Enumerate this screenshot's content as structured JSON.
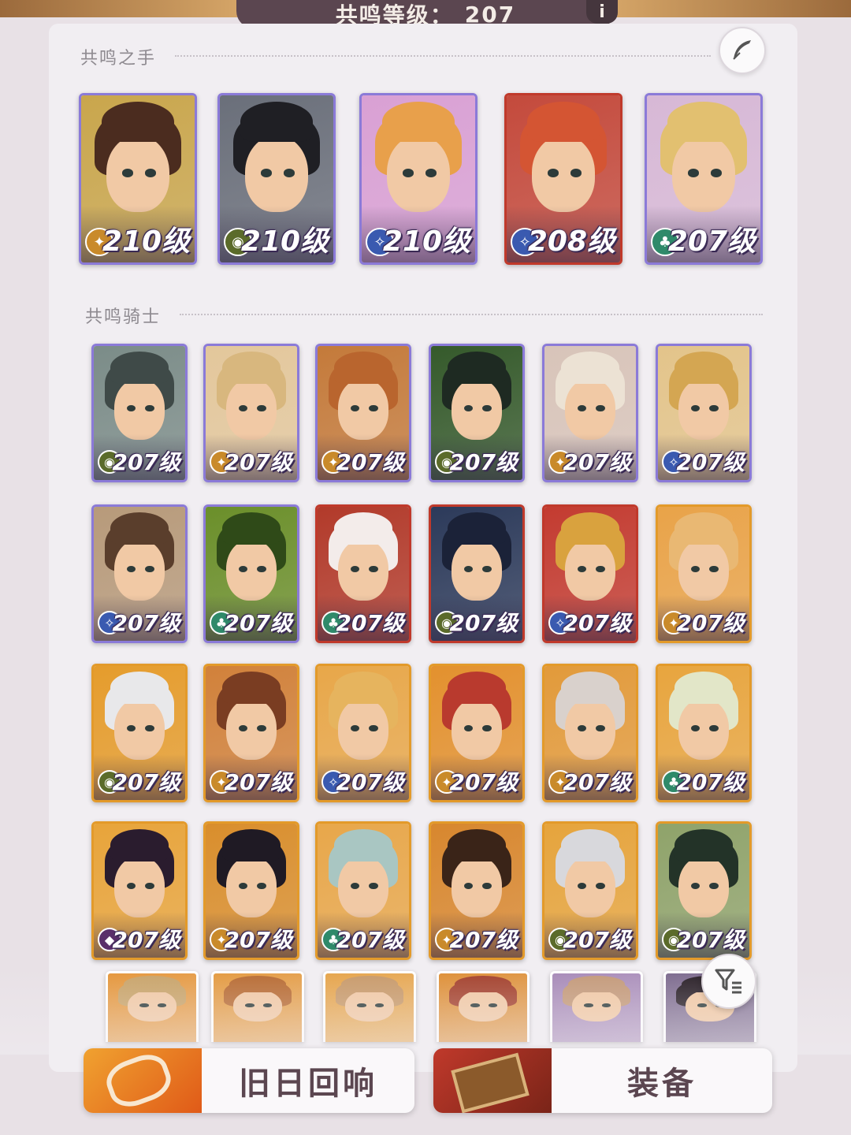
{
  "header": {
    "level_label": "共鸣等级：",
    "level_value": "207",
    "info_icon": "i"
  },
  "sections": {
    "hands_title": "共鸣之手",
    "knights_title": "共鸣骑士"
  },
  "hands": [
    {
      "level": "210级",
      "faction": "lightbearer",
      "frame": "purple",
      "hair": "#4b2c1f",
      "bg": "#c9a64c"
    },
    {
      "level": "210级",
      "faction": "mauler",
      "frame": "purple",
      "hair": "#1f1f24",
      "bg": "#6a6f7a"
    },
    {
      "level": "210级",
      "faction": "celestial",
      "frame": "purple",
      "hair": "#e8a04b",
      "bg": "#d9a0d4"
    },
    {
      "level": "208级",
      "faction": "celestial",
      "frame": "red",
      "hair": "#d45533",
      "bg": "#c44a3c"
    },
    {
      "level": "207级",
      "faction": "wilder",
      "frame": "purple",
      "hair": "#e2c070",
      "bg": "#d7b8d6"
    }
  ],
  "knights": [
    {
      "level": "207级",
      "faction": "mauler",
      "frame": "purple",
      "hair": "#3f4a48",
      "bg": "#7b8c88"
    },
    {
      "level": "207级",
      "faction": "lightbearer",
      "frame": "purple",
      "hair": "#d8b77e",
      "bg": "#e3c79b"
    },
    {
      "level": "207级",
      "faction": "lightbearer",
      "frame": "purple",
      "hair": "#b9652e",
      "bg": "#c47a3a"
    },
    {
      "level": "207级",
      "faction": "mauler",
      "frame": "purple",
      "hair": "#1e2a22",
      "bg": "#355a2b"
    },
    {
      "level": "207级",
      "faction": "lightbearer",
      "frame": "purple",
      "hair": "#ece2d4",
      "bg": "#d8c4b9"
    },
    {
      "level": "207级",
      "faction": "celestial",
      "frame": "purple",
      "hair": "#d4a652",
      "bg": "#e3c48a"
    },
    {
      "level": "207级",
      "faction": "celestial",
      "frame": "purple",
      "hair": "#5a3e2c",
      "bg": "#b79a7a"
    },
    {
      "level": "207级",
      "faction": "wilder",
      "frame": "purple",
      "hair": "#2f4a18",
      "bg": "#6b8f2a"
    },
    {
      "level": "207级",
      "faction": "wilder",
      "frame": "red",
      "hair": "#f3ecea",
      "bg": "#b23a2a"
    },
    {
      "level": "207级",
      "faction": "mauler",
      "frame": "red",
      "hair": "#1b2238",
      "bg": "#2c3a5a"
    },
    {
      "level": "207级",
      "faction": "celestial",
      "frame": "red",
      "hair": "#d9a23e",
      "bg": "#c33b30"
    },
    {
      "level": "207级",
      "faction": "lightbearer",
      "frame": "gold",
      "hair": "#e9b873",
      "bg": "#e9a348"
    },
    {
      "level": "207级",
      "faction": "mauler",
      "frame": "gold",
      "hair": "#e8e8ea",
      "bg": "#e59c2c"
    },
    {
      "level": "207级",
      "faction": "lightbearer",
      "frame": "gold",
      "hair": "#7a3d22",
      "bg": "#d1813a"
    },
    {
      "level": "207级",
      "faction": "celestial",
      "frame": "gold",
      "hair": "#e6b45e",
      "bg": "#e8a749"
    },
    {
      "level": "207级",
      "faction": "lightbearer",
      "frame": "gold",
      "hair": "#b93a2e",
      "bg": "#e3912e"
    },
    {
      "level": "207级",
      "faction": "lightbearer",
      "frame": "gold",
      "hair": "#d9d1cc",
      "bg": "#e29a3a"
    },
    {
      "level": "207级",
      "faction": "wilder",
      "frame": "gold",
      "hair": "#e2e6c8",
      "bg": "#e8a53e"
    },
    {
      "level": "207级",
      "faction": "graveborn",
      "frame": "gold",
      "hair": "#2a1c2e",
      "bg": "#e8a43a"
    },
    {
      "level": "207级",
      "faction": "lightbearer",
      "frame": "gold",
      "hair": "#1f1a24",
      "bg": "#d98e2c"
    },
    {
      "level": "207级",
      "faction": "wilder",
      "frame": "gold",
      "hair": "#a9c6c2",
      "bg": "#e8a74a"
    },
    {
      "level": "207级",
      "faction": "lightbearer",
      "frame": "gold",
      "hair": "#3a2418",
      "bg": "#d8872e"
    },
    {
      "level": "207级",
      "faction": "mauler",
      "frame": "gold",
      "hair": "#d8d8dc",
      "bg": "#e6a43c"
    },
    {
      "level": "207级",
      "faction": "mauler",
      "frame": "gold",
      "hair": "#233328",
      "bg": "#8fa36a"
    }
  ],
  "partial_row": [
    {
      "hair": "#c9a46a",
      "bg": "#e5963a"
    },
    {
      "hair": "#b86c34",
      "bg": "#e49a40"
    },
    {
      "hair": "#c89a6a",
      "bg": "#e6a44a"
    },
    {
      "hair": "#a4422e",
      "bg": "#de8f36"
    },
    {
      "hair": "#c49a7a",
      "bg": "#a78ab8"
    },
    {
      "hair": "#2a2028",
      "bg": "#7c6a8e"
    }
  ],
  "bottom": {
    "echo_label": "旧日回响",
    "equip_label": "装备"
  },
  "faction_colors": {
    "lightbearer": "#c98a2a",
    "mauler": "#5b6b2a",
    "wilder": "#2f8a6a",
    "graveborn": "#5a2f6a",
    "celestial": "#3a5ab0"
  },
  "frame_colors": {
    "purple": "#8b7ad8",
    "red": "#c0392b",
    "gold": "#e39a2a"
  }
}
